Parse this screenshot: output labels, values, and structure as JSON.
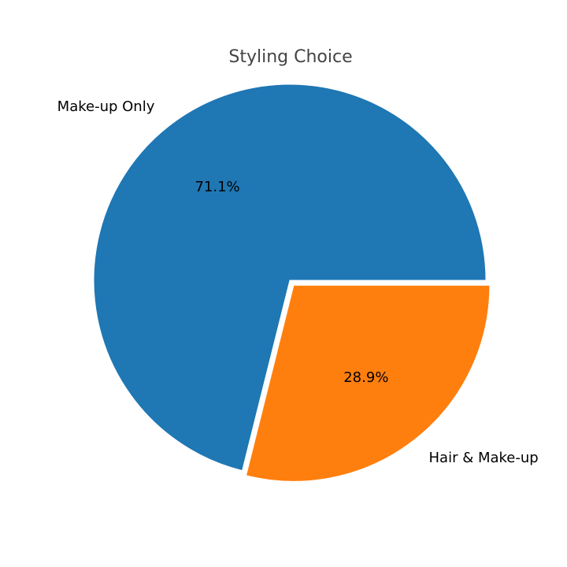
{
  "chart_data": {
    "type": "pie",
    "title": "Styling Choice",
    "categories": [
      "Make-up Only",
      "Hair & Make-up"
    ],
    "values": [
      71.1,
      28.9
    ],
    "value_labels": [
      "71.1%",
      "28.9%"
    ],
    "colors": [
      "#1f77b4",
      "#ff7f0e"
    ],
    "exploded": [
      false,
      true
    ],
    "start_angle_deg": 0,
    "direction": "counterclockwise"
  }
}
